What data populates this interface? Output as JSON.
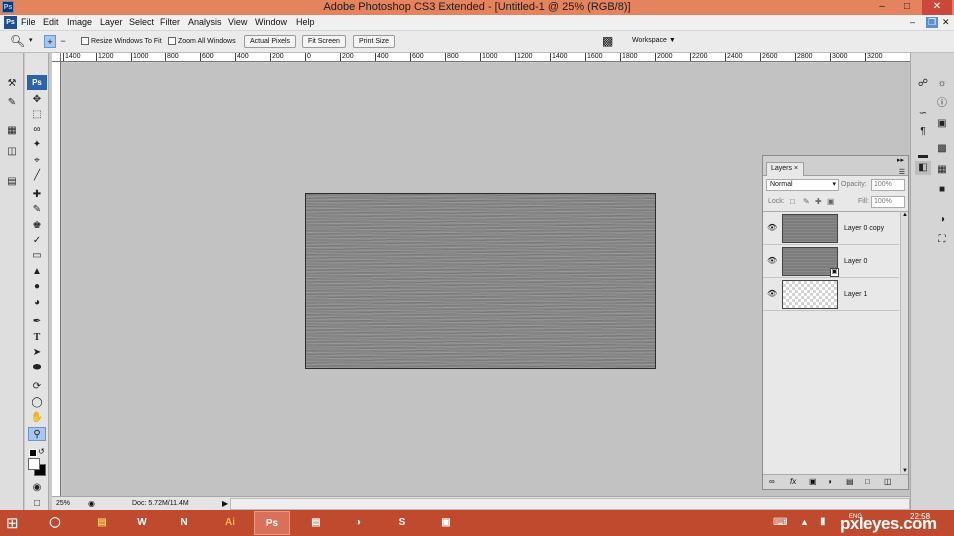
{
  "window": {
    "title": "Adobe Photoshop CS3 Extended - [Untitled-1 @ 25% (RGB/8)]",
    "app_icon": "Ps",
    "controls": {
      "minimize": "–",
      "maximize": "□",
      "close": "✕"
    },
    "doc_controls": {
      "minimize": "–",
      "restore": "❐",
      "close": "✕"
    }
  },
  "menu": {
    "items": [
      "File",
      "Edit",
      "Image",
      "Layer",
      "Select",
      "Filter",
      "Analysis",
      "View",
      "Window",
      "Help"
    ]
  },
  "options": {
    "resize_windows_label": "Resize Windows To Fit",
    "zoom_all_label": "Zoom All Windows",
    "actual_pixels_label": "Actual Pixels",
    "fit_screen_label": "Fit Screen",
    "print_size_label": "Print Size",
    "workspace_label": "Workspace"
  },
  "ruler": {
    "ticks": [
      "1400",
      "1200",
      "1000",
      "800",
      "600",
      "400",
      "200",
      "0",
      "200",
      "400",
      "600",
      "800",
      "1000",
      "1200",
      "1400",
      "1600",
      "1800",
      "2000",
      "2200",
      "2400",
      "2600",
      "2800",
      "3000",
      "3200"
    ]
  },
  "toolbox": {
    "ps_badge": "Ps",
    "tools": [
      "move-tool-icon",
      "marquee-tool-icon",
      "lasso-tool-icon",
      "magic-wand-icon",
      "crop-tool-icon",
      "slice-tool-icon",
      "healing-brush-icon",
      "brush-tool-icon",
      "clone-stamp-icon",
      "history-brush-icon",
      "eraser-tool-icon",
      "paint-bucket-icon",
      "blur-tool-icon",
      "dodge-tool-icon",
      "pen-tool-icon",
      "type-tool-icon",
      "path-selection-icon",
      "shape-tool-icon",
      "3d-rotate-icon",
      "eyedropper-icon",
      "hand-tool-icon",
      "zoom-tool-icon"
    ],
    "active_tool": "zoom-tool-icon"
  },
  "layers_panel": {
    "tab_label": "Layers",
    "blend_mode": "Normal",
    "opacity_label": "Opacity:",
    "opacity_value": "100%",
    "lock_label": "Lock:",
    "fill_label": "Fill:",
    "fill_value": "100%",
    "layers": [
      {
        "name": "Layer 0 copy",
        "thumb": "texture"
      },
      {
        "name": "Layer 0",
        "thumb": "texture"
      },
      {
        "name": "Layer 1",
        "thumb": "transparent"
      }
    ]
  },
  "status": {
    "zoom": "25%",
    "doc_info": "Doc: 5.72M/11.4M"
  },
  "taskbar": {
    "apps": [
      "Internet Explorer",
      "Chrome",
      "File Explorer",
      "Word",
      "OneNote",
      "Ai",
      "Ps",
      "Office",
      "Paint",
      "Skype",
      "Photo Viewer"
    ],
    "active_app": "Ps",
    "lang": "ENG",
    "time": "22:58",
    "watermark": "pxleyes.com"
  },
  "colors": {
    "titlebar": "#e4845f",
    "taskbar": "#c04a2e",
    "workspace": "#c2c2c2",
    "selection": "#a7c7ee"
  }
}
